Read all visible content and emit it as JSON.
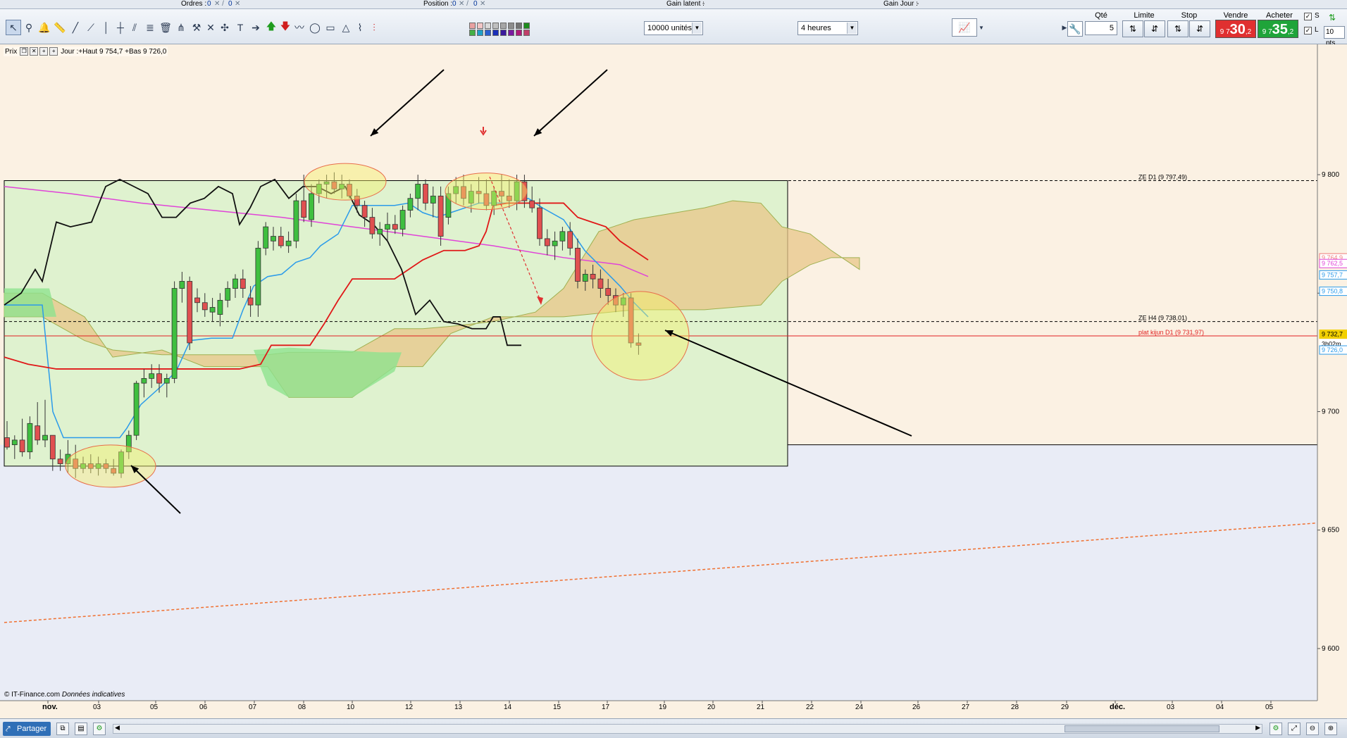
{
  "status": {
    "ordres_label": "Ordres :",
    "ordres_a": "0",
    "ordres_b": "0",
    "position_label": "Position :",
    "position_a": "0",
    "position_b": "0",
    "gain_latent_label": "Gain latent :",
    "gain_latent_value": "-",
    "gain_jour_label": "Gain Jour :",
    "gain_jour_value": "-"
  },
  "toolbar": {
    "units_select": "10000 unités",
    "period_select": "4 heures",
    "qty_label": "Qté",
    "qty_value": "5",
    "limit_label": "Limite",
    "stop_label": "Stop",
    "sell_label": "Vendre",
    "sell_price_small": "9 7",
    "sell_price_big": "30",
    "sell_price_dec": ",2",
    "buy_label": "Acheter",
    "buy_price_small": "9 7",
    "buy_price_big": "35",
    "buy_price_dec": ",2",
    "s_label": "S",
    "l_label": "L",
    "pts_value": "10 pts",
    "swatch_colors": [
      "#e9a1a1",
      "#f2c6c6",
      "#d9d9d9",
      "#bfbfbf",
      "#a6a6a6",
      "#8c8c8c",
      "#737373",
      "#1e8c1e",
      "#45b045",
      "#1f9fc7",
      "#2a5fd0",
      "#1a2fb8",
      "#3a1a9c",
      "#7a1aa0",
      "#b01a7a",
      "#c0406a"
    ]
  },
  "legend": {
    "prix": "Prix",
    "text": "Jour :+Haut 9 754,7 +Bas 9 726,0"
  },
  "copyright": {
    "main": "© IT-Finance.com",
    "italic": "Données indicatives"
  },
  "colors": {
    "bull": "#3fbf3f",
    "bear": "#e05050",
    "tenkan": "#e01818",
    "kijun": "#2b9bea",
    "chikou": "#101010",
    "ma": "#e044d8",
    "resistance": "#000000",
    "trendline": "#f07030"
  },
  "bottom": {
    "share_label": "Partager"
  },
  "chart_data": {
    "type": "candlestick",
    "title": "",
    "xlabel": "",
    "ylabel": "",
    "ylim": [
      9578,
      9855
    ],
    "yticks": [
      9800,
      9750,
      9700,
      9650,
      9600
    ],
    "ytick_labels": [
      "9 800",
      "9 750",
      "9 700",
      "9 650",
      "9 600"
    ],
    "xtick_labels": [
      "nov.",
      "03",
      "05",
      "06",
      "07",
      "08",
      "10",
      "12",
      "13",
      "14",
      "15",
      "17",
      "19",
      "20",
      "21",
      "22",
      "24",
      "26",
      "27",
      "28",
      "29",
      "déc.",
      "03",
      "04",
      "05"
    ],
    "horizontal_levels": [
      {
        "value": 9797.49,
        "label": "ZE D1 (9 797,49)",
        "style": "dashed"
      },
      {
        "value": 9738.01,
        "label": "ZE H4 (9 738,01)",
        "style": "dashed"
      },
      {
        "value": 9731.97,
        "label": "plat kijun D1 (9 731,97)",
        "style": "solid"
      }
    ],
    "right_price_tags": [
      {
        "value": 9764.9,
        "label": "9 764,9"
      },
      {
        "value": 9762.5,
        "label": "9 762,5"
      },
      {
        "value": 9757.7,
        "label": "9 757,7"
      },
      {
        "value": 9750.8,
        "label": "9 750,8"
      },
      {
        "value": 9732.7,
        "label": "9 732,7"
      },
      {
        "value": 9728.5,
        "label": "3h02m"
      },
      {
        "value": 9726.0,
        "label": "9 726,0"
      }
    ],
    "candles": [
      [
        9689,
        9696,
        9684,
        9685
      ],
      [
        9686,
        9690,
        9680,
        9688
      ],
      [
        9688,
        9697,
        9681,
        9683
      ],
      [
        9683,
        9698,
        9680,
        9695
      ],
      [
        9694,
        9704,
        9686,
        9688
      ],
      [
        9688,
        9705,
        9685,
        9690
      ],
      [
        9690,
        9690,
        9675,
        9680
      ],
      [
        9680,
        9684,
        9675,
        9678
      ],
      [
        9678,
        9688,
        9674,
        9682
      ],
      [
        9680,
        9686,
        9672,
        9676
      ],
      [
        9676,
        9681,
        9674,
        9678
      ],
      [
        9678,
        9682,
        9674,
        9676
      ],
      [
        9676,
        9681,
        9673,
        9678
      ],
      [
        9678,
        9680,
        9674,
        9676
      ],
      [
        9676,
        9680,
        9673,
        9674
      ],
      [
        9674,
        9684,
        9672,
        9683
      ],
      [
        9683,
        9692,
        9680,
        9690
      ],
      [
        9690,
        9713,
        9688,
        9712
      ],
      [
        9712,
        9718,
        9706,
        9714
      ],
      [
        9714,
        9720,
        9710,
        9716
      ],
      [
        9716,
        9720,
        9708,
        9712
      ],
      [
        9712,
        9716,
        9706,
        9714
      ],
      [
        9714,
        9755,
        9712,
        9752
      ],
      [
        9752,
        9759,
        9746,
        9755
      ],
      [
        9755,
        9757,
        9726,
        9729
      ],
      [
        9748,
        9752,
        9742,
        9746
      ],
      [
        9746,
        9750,
        9740,
        9743
      ],
      [
        9742,
        9748,
        9738,
        9744
      ],
      [
        9741,
        9750,
        9736,
        9747
      ],
      [
        9747,
        9755,
        9744,
        9752
      ],
      [
        9752,
        9758,
        9748,
        9756
      ],
      [
        9756,
        9760,
        9748,
        9752
      ],
      [
        9748,
        9753,
        9740,
        9745
      ],
      [
        9745,
        9772,
        9740,
        9769
      ],
      [
        9769,
        9780,
        9766,
        9778
      ],
      [
        9772,
        9778,
        9768,
        9774
      ],
      [
        9774,
        9778,
        9769,
        9770
      ],
      [
        9770,
        9776,
        9767,
        9772
      ],
      [
        9772,
        9792,
        9769,
        9789
      ],
      [
        9789,
        9800,
        9780,
        9782
      ],
      [
        9781,
        9796,
        9778,
        9792
      ],
      [
        9792,
        9798,
        9788,
        9796
      ],
      [
        9796,
        9800,
        9790,
        9797
      ],
      [
        9797,
        9801,
        9792,
        9794
      ],
      [
        9794,
        9800,
        9790,
        9796
      ],
      [
        9796,
        9798,
        9790,
        9791
      ],
      [
        9791,
        9794,
        9784,
        9787
      ],
      [
        9787,
        9789,
        9778,
        9782
      ],
      [
        9782,
        9786,
        9773,
        9775
      ],
      [
        9775,
        9780,
        9770,
        9777
      ],
      [
        9777,
        9784,
        9772,
        9779
      ],
      [
        9779,
        9783,
        9775,
        9777
      ],
      [
        9777,
        9787,
        9774,
        9785
      ],
      [
        9785,
        9792,
        9782,
        9790
      ],
      [
        9790,
        9800,
        9785,
        9796
      ],
      [
        9796,
        9798,
        9785,
        9788
      ],
      [
        9788,
        9795,
        9782,
        9791
      ],
      [
        9791,
        9795,
        9770,
        9774
      ],
      [
        9782,
        9795,
        9779,
        9792
      ],
      [
        9792,
        9799,
        9788,
        9795
      ],
      [
        9795,
        9800,
        9787,
        9790
      ],
      [
        9788,
        9796,
        9784,
        9793
      ],
      [
        9793,
        9799,
        9788,
        9792
      ],
      [
        9792,
        9798,
        9785,
        9787
      ],
      [
        9787,
        9795,
        9783,
        9793
      ],
      [
        9793,
        9800,
        9788,
        9791
      ],
      [
        9791,
        9798,
        9786,
        9789
      ],
      [
        9789,
        9800,
        9785,
        9797
      ],
      [
        9797,
        9800,
        9786,
        9789
      ],
      [
        9789,
        9795,
        9784,
        9786
      ],
      [
        9786,
        9790,
        9770,
        9773
      ],
      [
        9773,
        9777,
        9766,
        9770
      ],
      [
        9770,
        9776,
        9764,
        9772
      ],
      [
        9772,
        9778,
        9768,
        9776
      ],
      [
        9776,
        9780,
        9766,
        9769
      ],
      [
        9769,
        9773,
        9752,
        9755
      ],
      [
        9755,
        9760,
        9751,
        9758
      ],
      [
        9758,
        9762,
        9752,
        9756
      ],
      [
        9756,
        9760,
        9748,
        9752
      ],
      [
        9752,
        9756,
        9745,
        9749
      ],
      [
        9749,
        9752,
        9742,
        9745
      ],
      [
        9745,
        9750,
        9740,
        9748
      ],
      [
        9748,
        9750,
        9727,
        9729
      ],
      [
        9729,
        9733,
        9724,
        9728
      ]
    ]
  }
}
